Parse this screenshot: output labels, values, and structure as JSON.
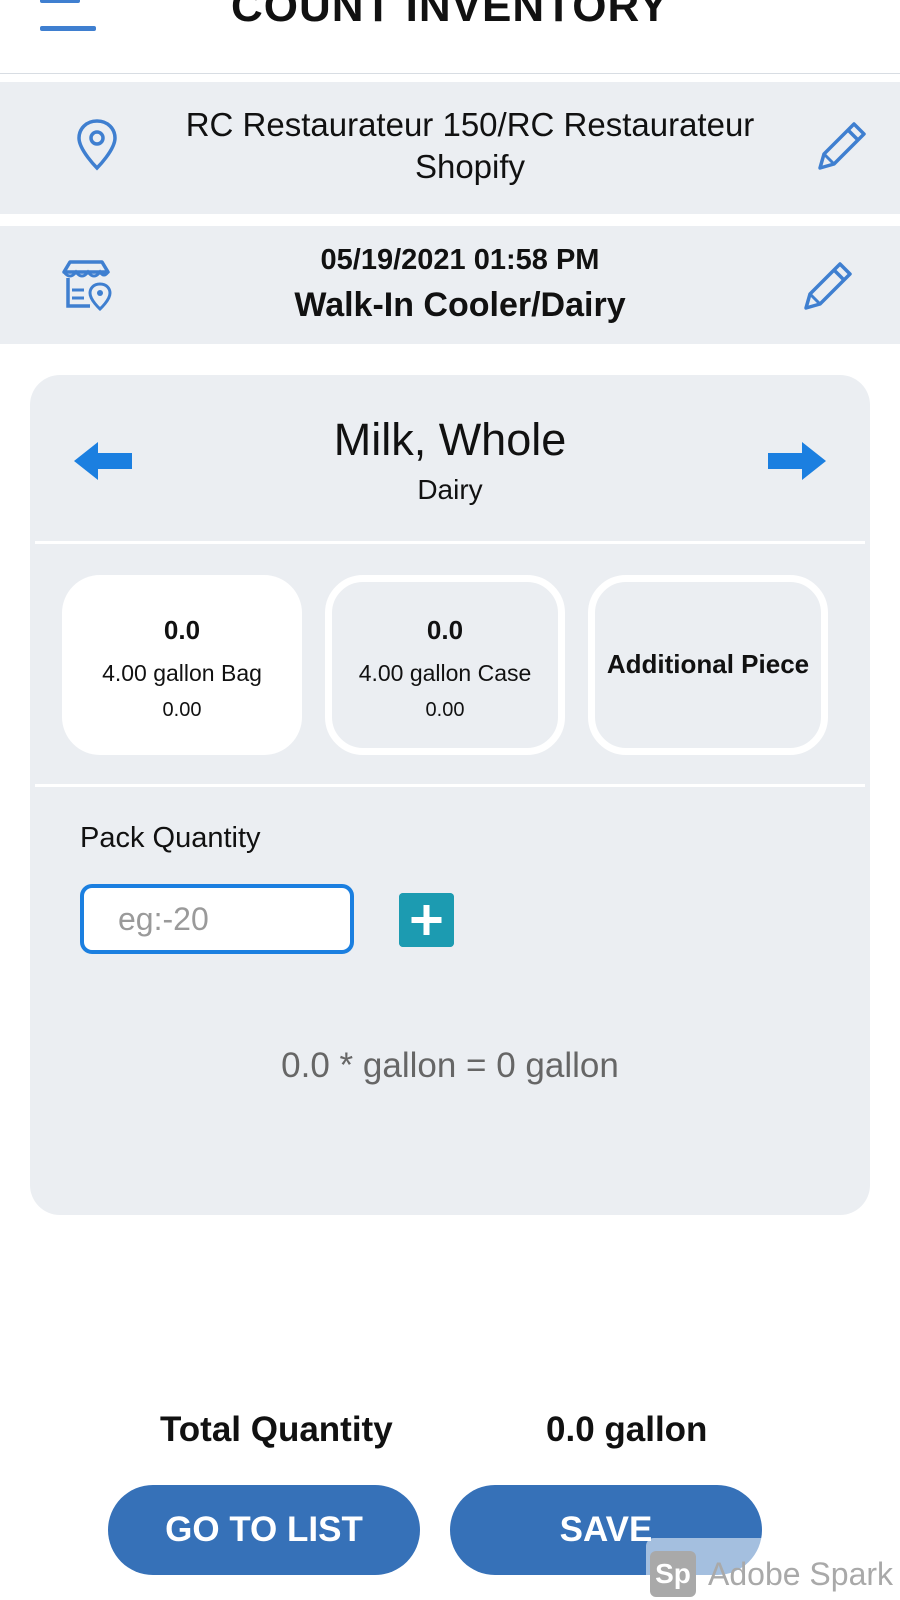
{
  "header": {
    "title": "COUNT INVENTORY"
  },
  "location": {
    "name": "RC Restaurateur 150/RC Restaurateur Shopify"
  },
  "storage": {
    "datetime": "05/19/2021 01:58 PM",
    "area": "Walk-In Cooler/Dairy"
  },
  "item": {
    "name": "Milk, Whole",
    "category": "Dairy"
  },
  "uoms": [
    {
      "count": "0.0",
      "label": "4.00 gallon Bag",
      "value": "0.00",
      "selected": true
    },
    {
      "count": "0.0",
      "label": "4.00 gallon Case",
      "value": "0.00",
      "selected": false
    },
    {
      "label": "Additional Piece",
      "selected": false
    }
  ],
  "pack": {
    "label": "Pack Quantity",
    "placeholder": "eg:-20",
    "value": ""
  },
  "calculation": "0.0 * gallon = 0 gallon",
  "total": {
    "label": "Total Quantity",
    "value": "0.0 gallon"
  },
  "buttons": {
    "go_to_list": "GO TO LIST",
    "save": "SAVE"
  },
  "watermark": {
    "logo": "Sp",
    "text": "Adobe Spark"
  },
  "colors": {
    "accent": "#1b7fe0",
    "button": "#3671b8",
    "plus": "#1c9bb1",
    "panel": "#ebeef2",
    "icon": "#3f7fd0"
  }
}
